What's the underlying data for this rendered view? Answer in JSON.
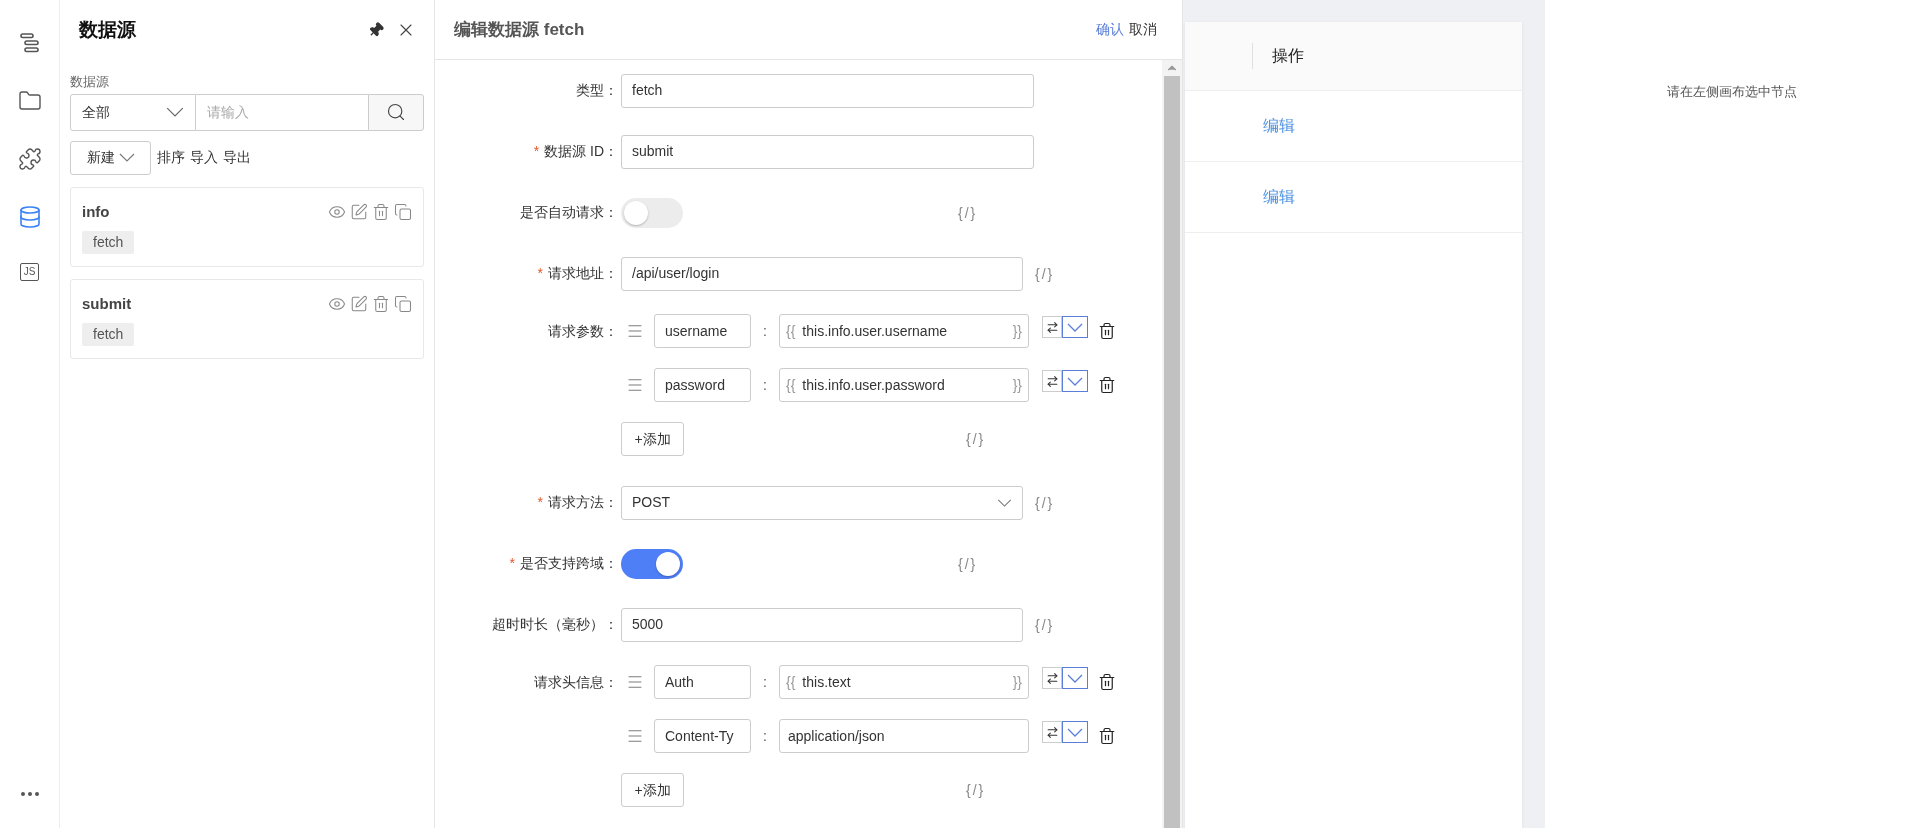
{
  "rail": {
    "items": [
      {
        "kind": "outline",
        "selected": false
      },
      {
        "kind": "folder",
        "selected": false
      },
      {
        "kind": "plugin",
        "selected": false
      },
      {
        "kind": "datasource",
        "selected": true
      },
      {
        "kind": "code",
        "selected": false,
        "label": "JS"
      },
      {
        "kind": "more",
        "selected": false
      }
    ]
  },
  "datasource_panel": {
    "title": "数据源",
    "filter_label": "数据源",
    "filter_select": "全部",
    "search_placeholder": "请输入",
    "new_button": "新建",
    "actions": [
      "排序",
      "导入",
      "导出"
    ],
    "cards": [
      {
        "name": "info",
        "type": "fetch"
      },
      {
        "name": "submit",
        "type": "fetch"
      }
    ]
  },
  "editor": {
    "title": "编辑数据源 fetch",
    "confirm": "确认",
    "cancel": "取消",
    "fields": [
      {
        "kind": "text",
        "label": "类型：",
        "value": "fetch"
      },
      {
        "kind": "text",
        "label": "数据源 ID：",
        "required_mark": "*",
        "value": "submit"
      },
      {
        "kind": "switch",
        "label": "是否自动请求：",
        "on": false,
        "expr": "{/}"
      },
      {
        "kind": "text",
        "label": "请求地址：",
        "required_mark": "*",
        "value": "/api/user/login",
        "expr": "{/}"
      },
      {
        "kind": "kv",
        "label": "请求参数：",
        "add": "+添加",
        "expr": "{/}",
        "rows": [
          {
            "key": "username",
            "separator": ":",
            "prefix": "{{",
            "value": "this.info.user.username",
            "suffix": "}}"
          },
          {
            "key": "password",
            "separator": ":",
            "prefix": "{{",
            "value": "this.info.user.password",
            "suffix": "}}"
          }
        ]
      },
      {
        "kind": "select",
        "label": "请求方法：",
        "required_mark": "*",
        "value": "POST",
        "expr": "{/}"
      },
      {
        "kind": "switch",
        "label": "是否支持跨域：",
        "required_mark": "*",
        "on": true,
        "expr": "{/}"
      },
      {
        "kind": "text",
        "label": "超时时长（毫秒）：",
        "value": "5000",
        "expr": "{/}"
      },
      {
        "kind": "kv",
        "label": "请求头信息：",
        "add": "+添加",
        "expr": "{/}",
        "rows": [
          {
            "key": "Auth",
            "separator": ":",
            "prefix": "{{",
            "value": "this.text",
            "suffix": "}}"
          },
          {
            "key": "Content-Ty",
            "separator": ":",
            "value": "application/json"
          }
        ]
      }
    ]
  },
  "canvas_table": {
    "header": "操作",
    "rows": [
      "编辑",
      "编辑"
    ]
  },
  "inspector": {
    "empty_text": "请在左侧画布选中节点"
  }
}
